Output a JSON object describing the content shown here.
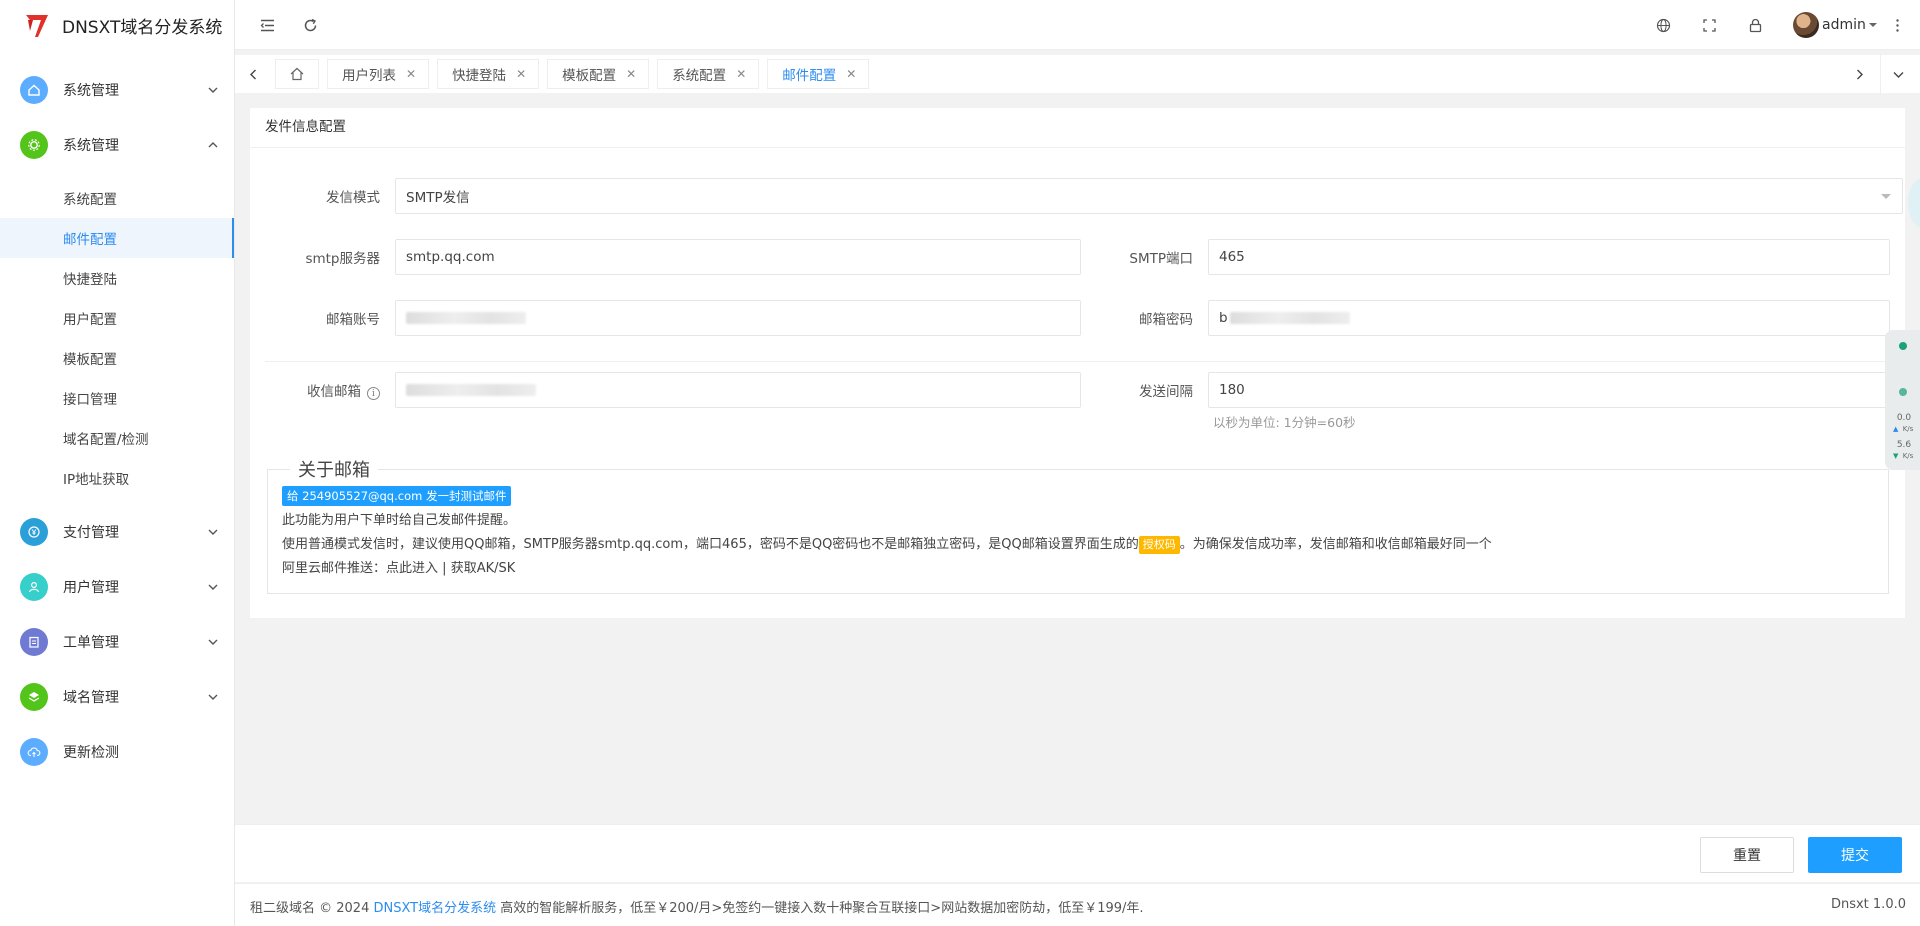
{
  "app": {
    "title": "DNSXT域名分发系统"
  },
  "colors": {
    "accent": "#2d8cf0",
    "primary_button": "#1e9fff",
    "warning_tag": "#ffb800",
    "logo_red": "#e0312a"
  },
  "sidebar": {
    "menus": [
      {
        "label": "系统管理",
        "icon": "home-icon",
        "icon_color": "#5cadff",
        "expanded": false
      },
      {
        "label": "系统管理",
        "icon": "gear-icon",
        "icon_color": "#52c41a",
        "expanded": true
      },
      {
        "label": "支付管理",
        "icon": "yen-icon",
        "icon_color": "#2b9fd8",
        "expanded": false
      },
      {
        "label": "用户管理",
        "icon": "user-icon",
        "icon_color": "#36cfc9",
        "expanded": false
      },
      {
        "label": "工单管理",
        "icon": "clipboard-icon",
        "icon_color": "#6f7ad3",
        "expanded": false
      },
      {
        "label": "域名管理",
        "icon": "layers-icon",
        "icon_color": "#52c41a",
        "expanded": false
      },
      {
        "label": "更新检测",
        "icon": "cloud-upload-icon",
        "icon_color": "#5cadff",
        "expanded": false
      }
    ],
    "submenu": [
      "系统配置",
      "邮件配置",
      "快捷登陆",
      "用户配置",
      "模板配置",
      "接口管理",
      "域名配置/检测",
      "IP地址获取"
    ],
    "active_sub": "邮件配置"
  },
  "header": {
    "username": "admin"
  },
  "tabs": [
    {
      "label": "用户列表",
      "active": false
    },
    {
      "label": "快捷登陆",
      "active": false
    },
    {
      "label": "模板配置",
      "active": false
    },
    {
      "label": "系统配置",
      "active": false
    },
    {
      "label": "邮件配置",
      "active": true
    }
  ],
  "panel": {
    "title": "发件信息配置",
    "send_mode": {
      "label": "发信模式",
      "value": "SMTP发信"
    },
    "smtp_server": {
      "label": "smtp服务器",
      "value": "smtp.qq.com"
    },
    "smtp_port": {
      "label": "SMTP端口",
      "value": "465"
    },
    "mail_account": {
      "label": "邮箱账号",
      "value": ""
    },
    "mail_password": {
      "label": "邮箱密码",
      "value": "b"
    },
    "receive_mail": {
      "label": "收信邮箱",
      "value": ""
    },
    "send_interval": {
      "label": "发送间隔",
      "value": "180",
      "hint": "以秒为单位: 1分钟=60秒"
    }
  },
  "about": {
    "legend": "关于邮箱",
    "test_button": "给 254905527@qq.com 发一封测试邮件",
    "line1": "此功能为用户下单时给自己发邮件提醒。",
    "line2_pre": "使用普通模式发信时，建议使用QQ邮箱，SMTP服务器smtp.qq.com，端口465，密码不是QQ密码也不是邮箱独立密码，是QQ邮箱设置界面生成的",
    "line2_tag": "授权码",
    "line2_post": "。为确保发信成功率，发信邮箱和收信邮箱最好同一个",
    "line3_prefix": "阿里云邮件推送：",
    "line3_link1": "点此进入",
    "line3_sep": " | ",
    "line3_link2": "获取AK/SK"
  },
  "side_widget": {
    "up_value": "0.0",
    "up_unit": "K/s",
    "down_value": "5.6",
    "down_unit": "K/s"
  },
  "actions": {
    "reset": "重置",
    "submit": "提交"
  },
  "footer": {
    "prefix": "租二级域名 © 2024 ",
    "brand": "DNSXT域名分发系统",
    "suffix": " 高效的智能解析服务，低至￥200/月>免签约一键接入数十种聚合互联接口>网站数据加密防劫，低至￥199/年.",
    "version": "Dnsxt 1.0.0"
  }
}
